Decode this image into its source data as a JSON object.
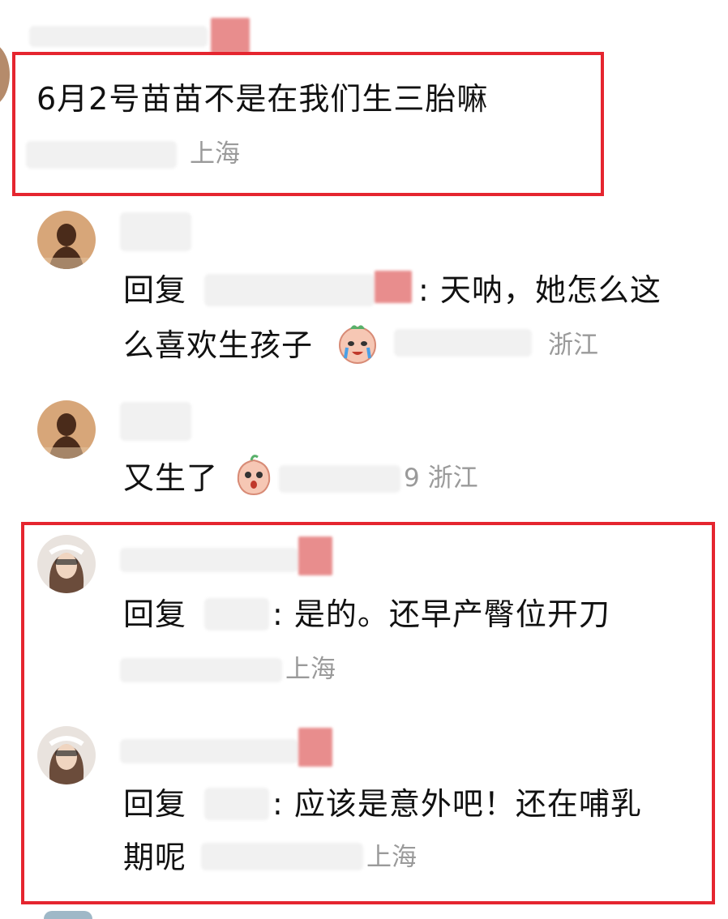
{
  "comment_main": {
    "text": "6月2号苗苗不是在我们生三胎嘛",
    "location": "上海"
  },
  "reply_1": {
    "prefix": "回复",
    "body_line1": ": 天呐，她怎么这",
    "body_line2": "么喜欢生孩子",
    "location": "浙江",
    "emoji": "crying-emoji"
  },
  "reply_2": {
    "text": "又生了",
    "location_suffix": "9 浙江",
    "emoji": "shocked-peach-emoji"
  },
  "reply_3": {
    "prefix": "回复",
    "body": ": 是的。还早产臀位开刀",
    "location": "上海"
  },
  "reply_4": {
    "prefix": "回复",
    "body_line1": ": 应该是意外吧！还在哺乳",
    "body_line2": "期呢",
    "location": "上海"
  },
  "colors": {
    "highlight": "#e5252f",
    "meta_text": "#9a9a9a",
    "primary_text": "#111111"
  }
}
